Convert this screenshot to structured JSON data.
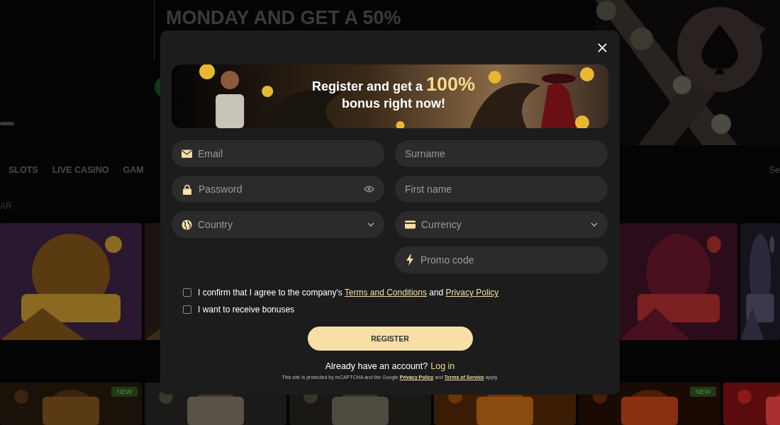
{
  "hero": {
    "headline": "MONDAY AND GET A 50%"
  },
  "nav": {
    "items": [
      {
        "label": "SLOTS"
      },
      {
        "label": "LIVE CASINO"
      },
      {
        "label": "GAM"
      }
    ],
    "search_partial": "Se"
  },
  "section_label": "AR",
  "games_row_1": [
    {
      "kind": "picture"
    },
    {
      "kind": "picture"
    },
    {
      "kind": "picture"
    },
    {
      "kind": "picture"
    }
  ],
  "games_row_2": [
    {
      "kind": "picture",
      "badge": "NEW"
    },
    {
      "kind": "picture"
    },
    {
      "kind": "picture"
    },
    {
      "kind": "picture"
    },
    {
      "kind": "picture",
      "badge": "NEW"
    },
    {
      "kind": "picture"
    }
  ],
  "modal": {
    "banner": {
      "title_start": "Register and get a",
      "highlight": "100%",
      "title_end": "bonus right now!"
    },
    "left_fields": [
      {
        "kind": "email",
        "placeholder": "Email"
      },
      {
        "kind": "password",
        "placeholder": "Password"
      },
      {
        "kind": "country",
        "placeholder": "Country"
      }
    ],
    "right_fields": [
      {
        "kind": "text",
        "placeholder": "Surname"
      },
      {
        "kind": "text",
        "placeholder": "First name"
      },
      {
        "kind": "currency",
        "placeholder": "Currency"
      },
      {
        "kind": "promo",
        "placeholder": "Promo code"
      }
    ],
    "checkboxes": [
      {
        "checked": false,
        "segments": [
          {
            "kind": "text",
            "text": "I confirm that I agree to the company's "
          },
          {
            "kind": "link",
            "text": "Terms and Conditions"
          },
          {
            "kind": "text",
            "text": " and "
          },
          {
            "kind": "link",
            "text": "Privacy Policy"
          }
        ]
      },
      {
        "checked": false,
        "segments": [
          {
            "kind": "text",
            "text": "I want to receive bonuses"
          }
        ]
      }
    ],
    "register_button": "REGISTER",
    "login_prompt": "Already have an account?",
    "login_link": "Log in",
    "recaptcha": [
      {
        "kind": "text",
        "text": "This site is protected by reCAPTCHA and the Google "
      },
      {
        "kind": "link",
        "text": "Privacy Policy"
      },
      {
        "kind": "text",
        "text": " and "
      },
      {
        "kind": "link",
        "text": "Terms of Service"
      },
      {
        "kind": "text",
        "text": " apply."
      }
    ]
  }
}
